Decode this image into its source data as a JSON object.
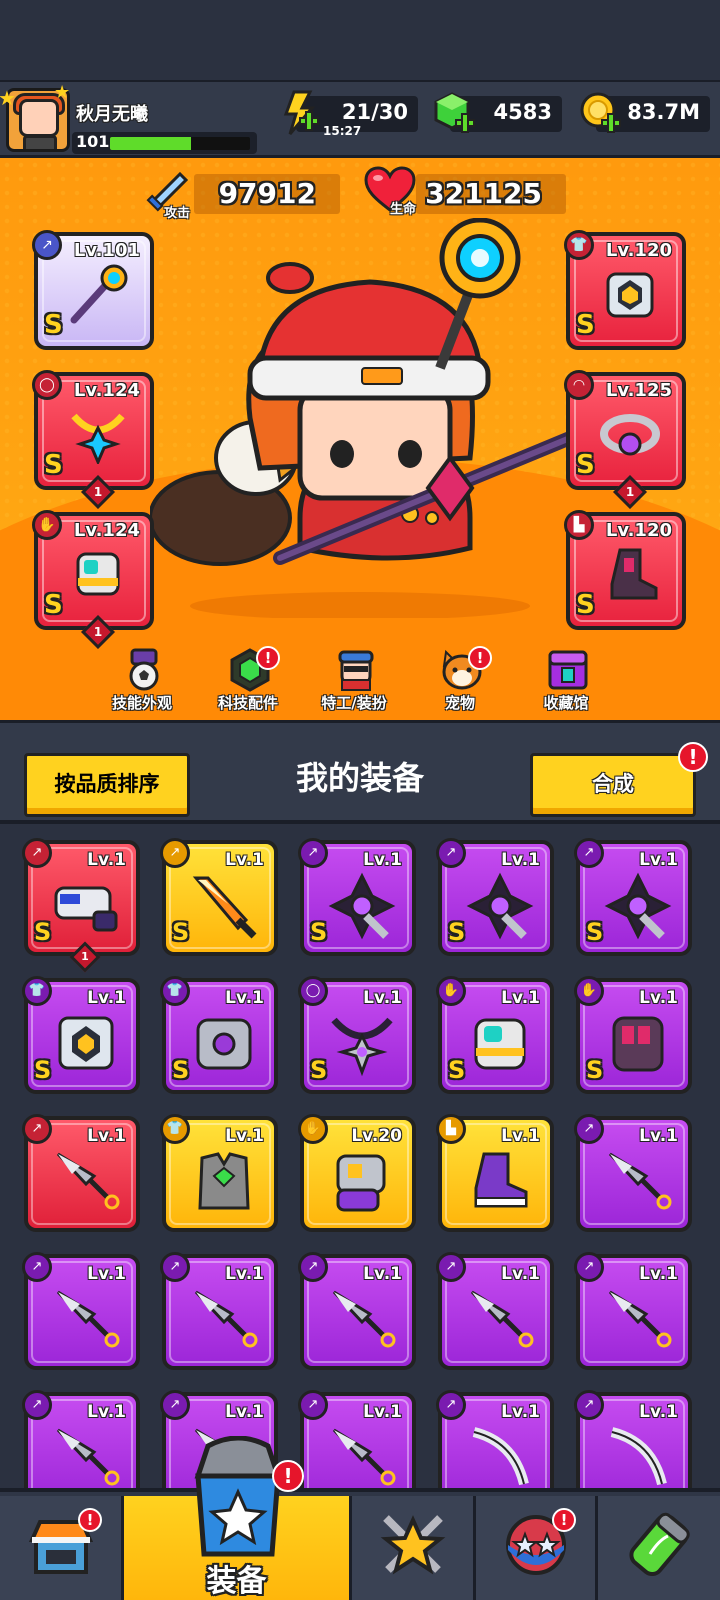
{
  "player": {
    "name": "秋月无曦",
    "level": "101",
    "xp_fraction": 0.58
  },
  "resources": {
    "energy": "21/30",
    "energy_timer": "15:27",
    "gems": "4583",
    "coins": "83.7M"
  },
  "stats": {
    "attack_label": "攻击",
    "attack": "97912",
    "hp_label": "生命",
    "hp": "321125"
  },
  "equipped": {
    "weapon": {
      "level": "Lv.101",
      "grade": "S"
    },
    "necklace": {
      "level": "Lv.124",
      "grade": "S",
      "stars": "1"
    },
    "gloves": {
      "level": "Lv.124",
      "grade": "S",
      "stars": "1"
    },
    "armor": {
      "level": "Lv.120",
      "grade": "S"
    },
    "belt": {
      "level": "Lv.125",
      "grade": "S",
      "stars": "1"
    },
    "boots": {
      "level": "Lv.120",
      "grade": "S"
    }
  },
  "functions": [
    {
      "label": "技能外观",
      "badge": ""
    },
    {
      "label": "科技配件",
      "badge": "!"
    },
    {
      "label": "特工/装扮",
      "badge": ""
    },
    {
      "label": "宠物",
      "badge": "!"
    },
    {
      "label": "收藏馆",
      "badge": ""
    }
  ],
  "panel": {
    "sort_label": "按品质排序",
    "title": "我的装备",
    "merge_label": "合成",
    "merge_badge": "!"
  },
  "inventory": [
    {
      "level": "Lv.1",
      "grade": "S",
      "rarity": "red",
      "icon": "blaster-icon",
      "stars": "1"
    },
    {
      "level": "Lv.1",
      "grade": "S",
      "rarity": "gold",
      "icon": "sword-icon",
      "stars": ""
    },
    {
      "level": "Lv.1",
      "grade": "S",
      "rarity": "purple",
      "icon": "drill-icon",
      "stars": ""
    },
    {
      "level": "Lv.1",
      "grade": "S",
      "rarity": "purple",
      "icon": "drill-icon",
      "stars": ""
    },
    {
      "level": "Lv.1",
      "grade": "S",
      "rarity": "purple",
      "icon": "drill-icon",
      "stars": ""
    },
    {
      "level": "Lv.1",
      "grade": "S",
      "rarity": "purple",
      "icon": "mech-armor-icon",
      "stars": ""
    },
    {
      "level": "Lv.1",
      "grade": "S",
      "rarity": "purple",
      "icon": "plate-armor-icon",
      "stars": ""
    },
    {
      "level": "Lv.1",
      "grade": "S",
      "rarity": "purple",
      "icon": "necklace-icon",
      "stars": ""
    },
    {
      "level": "Lv.1",
      "grade": "S",
      "rarity": "purple",
      "icon": "gauntlet-icon",
      "stars": ""
    },
    {
      "level": "Lv.1",
      "grade": "S",
      "rarity": "purple",
      "icon": "dark-gauntlet-icon",
      "stars": ""
    },
    {
      "level": "Lv.1",
      "grade": "",
      "rarity": "red",
      "icon": "kunai-icon",
      "stars": ""
    },
    {
      "level": "Lv.1",
      "grade": "",
      "rarity": "gold",
      "icon": "vest-icon",
      "stars": ""
    },
    {
      "level": "Lv.20",
      "grade": "",
      "rarity": "gold",
      "icon": "glove-icon",
      "stars": ""
    },
    {
      "level": "Lv.1",
      "grade": "",
      "rarity": "gold",
      "icon": "boot-icon",
      "stars": ""
    },
    {
      "level": "Lv.1",
      "grade": "",
      "rarity": "purple",
      "icon": "kunai-icon",
      "stars": ""
    },
    {
      "level": "Lv.1",
      "grade": "",
      "rarity": "purple",
      "icon": "kunai-icon",
      "stars": ""
    },
    {
      "level": "Lv.1",
      "grade": "",
      "rarity": "purple",
      "icon": "kunai-icon",
      "stars": ""
    },
    {
      "level": "Lv.1",
      "grade": "",
      "rarity": "purple",
      "icon": "kunai-icon",
      "stars": ""
    },
    {
      "level": "Lv.1",
      "grade": "",
      "rarity": "purple",
      "icon": "kunai-icon",
      "stars": ""
    },
    {
      "level": "Lv.1",
      "grade": "",
      "rarity": "purple",
      "icon": "kunai-icon",
      "stars": ""
    },
    {
      "level": "Lv.1",
      "grade": "",
      "rarity": "purple",
      "icon": "kunai-icon",
      "stars": ""
    },
    {
      "level": "Lv.1",
      "grade": "",
      "rarity": "purple",
      "icon": "kunai-icon",
      "stars": ""
    },
    {
      "level": "Lv.1",
      "grade": "",
      "rarity": "purple",
      "icon": "kunai-icon",
      "stars": ""
    },
    {
      "level": "Lv.1",
      "grade": "",
      "rarity": "purple",
      "icon": "blade-icon",
      "stars": ""
    },
    {
      "level": "Lv.1",
      "grade": "",
      "rarity": "purple",
      "icon": "blade-icon",
      "stars": ""
    }
  ],
  "nav": {
    "active_label": "装备",
    "shop_badge": "!",
    "equip_badge": "!",
    "events_badge": "!"
  },
  "colors": {
    "accent": "#ffd21f",
    "red": "#e8223d",
    "purple": "#a52ee0",
    "gold": "#ffb50a"
  }
}
